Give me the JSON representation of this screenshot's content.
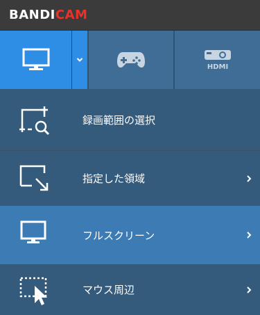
{
  "app": {
    "logo_part1": "BANDI",
    "logo_part2": "CAM"
  },
  "tabs": [
    {
      "name": "screen-record-mode",
      "icon": "monitor-icon",
      "active": true
    },
    {
      "name": "mode-dropdown",
      "icon": "chevron-down-icon",
      "active": true
    },
    {
      "name": "game-record-mode",
      "icon": "gamepad-icon",
      "active": false
    },
    {
      "name": "device-record-mode",
      "icon": "hdmi-icon",
      "active": false,
      "icon_text": "HDMI"
    }
  ],
  "menu": {
    "items": [
      {
        "label": "録画範囲の選択",
        "icon": "select-area-icon",
        "has_arrow": false,
        "selected": false
      },
      {
        "label": "指定した領域",
        "icon": "resize-region-icon",
        "has_arrow": true,
        "selected": false
      },
      {
        "label": "フルスクリーン",
        "icon": "fullscreen-monitor-icon",
        "has_arrow": true,
        "selected": true
      },
      {
        "label": "マウス周辺",
        "icon": "mouse-cursor-area-icon",
        "has_arrow": true,
        "selected": false
      }
    ]
  },
  "colors": {
    "accent": "#2e8ee6",
    "brand_red": "#e8332a",
    "menu_bg": "#365e80",
    "menu_selected": "#3e80bc"
  }
}
